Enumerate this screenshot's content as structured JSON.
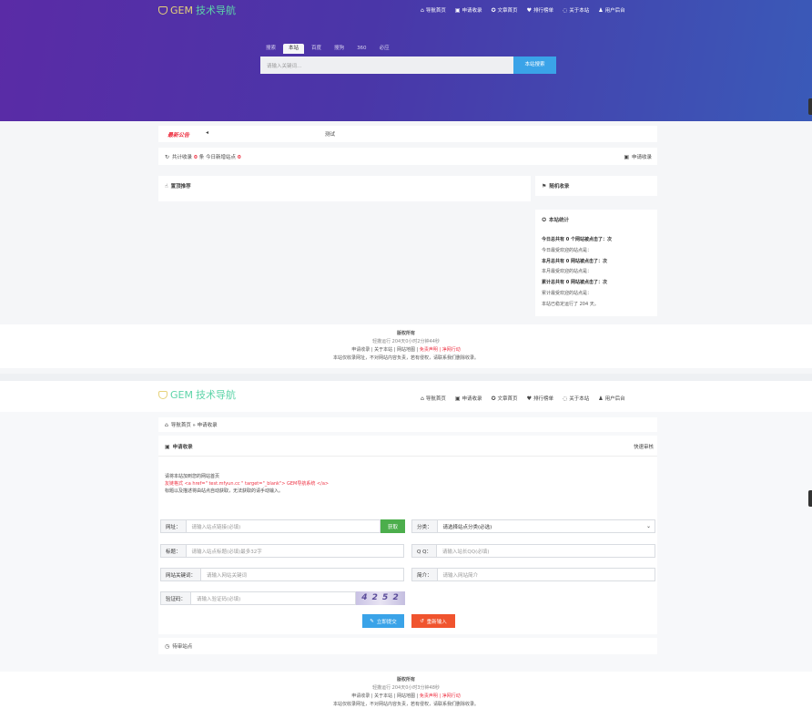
{
  "brand": {
    "logo_prefix": "GEM",
    "logo_suffix": "技术导航"
  },
  "nav": [
    {
      "icon": "home-icon",
      "glyph": "⌂",
      "label": "导航首页"
    },
    {
      "icon": "apply-icon",
      "glyph": "▣",
      "label": "申请收录"
    },
    {
      "icon": "article-icon",
      "glyph": "✪",
      "label": "文章首页"
    },
    {
      "icon": "rank-icon",
      "glyph": "♥",
      "label": "排行榜单"
    },
    {
      "icon": "about-icon",
      "glyph": "◌",
      "label": "关于本站"
    },
    {
      "icon": "user-icon",
      "glyph": "♟",
      "label": "用户后台"
    }
  ],
  "search": {
    "tabs": [
      "搜索",
      "本站",
      "百度",
      "搜狗",
      "360",
      "必应"
    ],
    "active_tab": "本站",
    "placeholder": "请输入关键词...",
    "button": "本站搜索"
  },
  "notice": {
    "label": "最新公告",
    "text": "测试"
  },
  "stats_bar": {
    "left": "共计收录 0 条  今日新增站点 0",
    "count_total": "0",
    "count_today": "0",
    "right": "申请收录"
  },
  "panels": {
    "recommend": "置顶推荐",
    "random": "随机收录",
    "site_stats": "本站统计"
  },
  "site_stats": [
    {
      "text": "今日总共有 0 个网站被点击了：次",
      "bold": true
    },
    {
      "text": "今日最受欢迎的站点是：",
      "bold": false
    },
    {
      "text": "本月总共有 0 网站被点击了：次",
      "bold": true
    },
    {
      "text": "本月最受欢迎的站点是：",
      "bold": false
    },
    {
      "text": "累计总共有 0 网站被点击了：次",
      "bold": true
    },
    {
      "text": "累计最受欢迎的站点是：",
      "bold": false
    },
    {
      "text": "本站已稳定运行了 204 天。",
      "bold": false
    }
  ],
  "footer": {
    "title": "版权所有",
    "uptime_1": "轻撒运行 204天0小时2分钟44秒",
    "uptime_2": "轻撒运行 204天0小时3分钟48秒",
    "links": "申请收录 | 关于本站 | 网站地图 |",
    "links_red": "免责声明 | 净网行动",
    "disclaimer": "本站仅收录网址，不对网站内容负责，若有侵权，请联系我们删除收录。"
  },
  "apply": {
    "breadcrumb": "导航首页 » 申请收录",
    "title": "申请收录",
    "quick": "快速审核",
    "intro_1": "请将本站加到您的网站首页",
    "intro_2": "友链格式 <a href=\" test.mfyun.cc \" target=\"_blank\"> GEM导航系统 </a>",
    "intro_3": "标题以及描述将由站点自动获取，无法获取的请手动输入。",
    "url_label": "网址：",
    "url_ph": "请输入站点链接(必填)",
    "fetch": "获取",
    "cat_label": "分类：",
    "cat_value": "请选择站点分类(必选)",
    "title_label": "标题：",
    "title_ph": "请输入站点标题(必填)最多32字",
    "qq_label": "Q Q：",
    "qq_ph": "请输入站长QQ(必填)",
    "kw_label": "网站关键词：",
    "kw_ph": "请输入网站关键词",
    "desc_label": "简介：",
    "desc_ph": "请输入网站简介",
    "captcha_label": "验证码：",
    "captcha_ph": "请输入验证码(必填)",
    "captcha_text": "4 2 5 2",
    "submit": "立即提交",
    "reset": "重新输入",
    "pending": "待审站点"
  },
  "colors": {
    "hero_start": "#5a2ba6",
    "hero_end": "#3a5ab8",
    "accent_blue": "#3aa3e8",
    "fetch_green": "#4cae4c",
    "reset_orange": "#f0542e",
    "red": "#e33344"
  }
}
